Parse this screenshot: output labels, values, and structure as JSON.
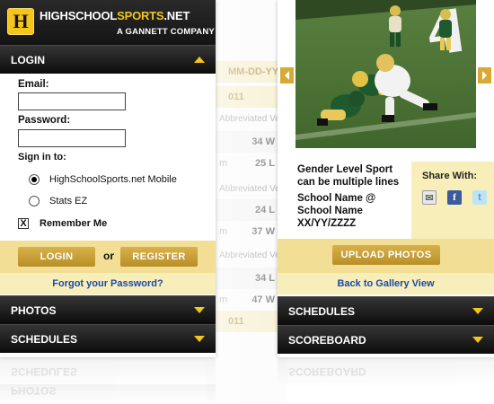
{
  "background_screen": {
    "rows": [
      {
        "kind": "header",
        "text": "MM-DD-YYY"
      },
      {
        "kind": "header",
        "text": "011"
      },
      {
        "kind": "sub",
        "text": "Abbreviated Ver"
      },
      {
        "kind": "data",
        "left": "",
        "right": "34 W"
      },
      {
        "kind": "data",
        "left": "m",
        "right": "25 L"
      },
      {
        "kind": "sub",
        "text": "Abbreviated Ver"
      },
      {
        "kind": "data",
        "left": "",
        "right": "24 L"
      },
      {
        "kind": "data",
        "left": "m",
        "right": "37 W"
      },
      {
        "kind": "sub",
        "text": "Abbreviated Ver"
      },
      {
        "kind": "data",
        "left": "",
        "right": "34 L"
      },
      {
        "kind": "data",
        "left": "m",
        "right": "47 W"
      },
      {
        "kind": "header",
        "text": "011"
      }
    ]
  },
  "left_screen": {
    "brand": {
      "logo_letter": "H",
      "name_part1": "HIGHSCHOOL",
      "name_part2": "SPORTS",
      "name_part3": ".NET",
      "company": "A GANNETT COMPANY"
    },
    "login_section": {
      "label": "LOGIN",
      "state": "expanded"
    },
    "form": {
      "email_label": "Email:",
      "email_value": "",
      "password_label": "Password:",
      "password_value": "",
      "sign_in_to_label": "Sign in to:",
      "options": [
        "HighSchoolSports.net Mobile",
        "Stats EZ"
      ],
      "selected_option": "HighSchoolSports.net Mobile",
      "remember_me_label": "Remember Me",
      "remember_me_mark": "X"
    },
    "buttons": {
      "login": "LOGIN",
      "or": "or",
      "register": "REGISTER"
    },
    "forgot_password": "Forgot your Password?",
    "sections": [
      "PHOTOS",
      "SCHEDULES"
    ],
    "reflections": [
      "SCHEDULES",
      "PHOTOS"
    ]
  },
  "right_screen": {
    "photo_subject": "football-action-photo",
    "caption": {
      "line1": "Gender Level Sport",
      "line2": "can be multiple lines",
      "line3": "School Name @",
      "line4": "School Name",
      "line5": "XX/YY/ZZZZ"
    },
    "share": {
      "title": "Share With:",
      "icons": [
        "email-icon",
        "facebook-icon",
        "twitter-icon"
      ],
      "facebook_glyph": "f",
      "twitter_glyph": "t"
    },
    "upload_button": "UPLOAD PHOTOS",
    "back_link": "Back to Gallery View",
    "sections": [
      "SCHEDULES",
      "SCOREBOARD"
    ],
    "reflections": [
      "SCOREBOARD"
    ]
  },
  "colors": {
    "accent_gold": "#f4c51b",
    "button_gold": "#c9a03a",
    "band_yellow": "#f2df95",
    "band_light": "#f8eeb9",
    "link_blue": "#1b49a8",
    "bar_black": "#111111"
  }
}
